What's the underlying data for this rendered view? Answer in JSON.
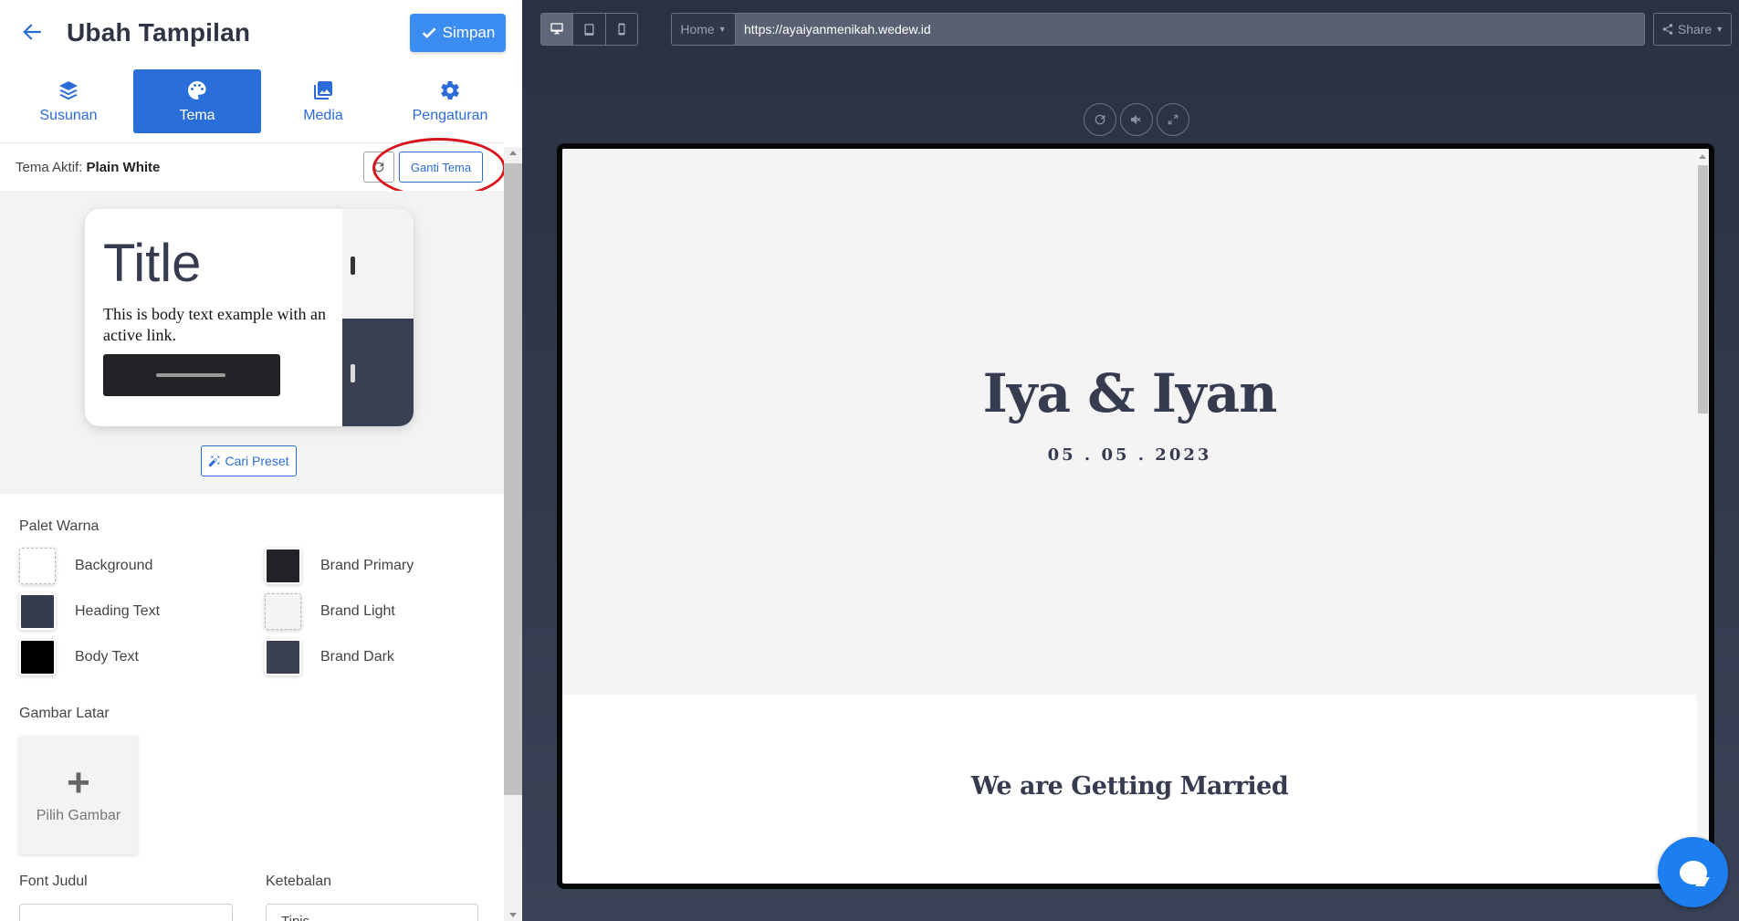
{
  "header": {
    "title": "Ubah Tampilan",
    "save_label": "Simpan"
  },
  "tabs": [
    {
      "label": "Susunan",
      "icon": "layers-icon"
    },
    {
      "label": "Tema",
      "icon": "palette-icon",
      "active": true
    },
    {
      "label": "Media",
      "icon": "images-icon"
    },
    {
      "label": "Pengaturan",
      "icon": "gear-icon"
    }
  ],
  "theme": {
    "active_prefix": "Tema Aktif:",
    "active_name": "Plain White",
    "change_label": "Ganti Tema",
    "preview": {
      "title": "Title",
      "body": "This is body text example with an active link."
    },
    "preset_label": "Cari Preset"
  },
  "palette": {
    "heading": "Palet Warna",
    "colors": [
      {
        "label": "Background",
        "color": "#ffffff"
      },
      {
        "label": "Brand Primary",
        "color": "#222326"
      },
      {
        "label": "Heading Text",
        "color": "#363b4f"
      },
      {
        "label": "Brand Light",
        "color": "#f4f4f5"
      },
      {
        "label": "Body Text",
        "color": "#000000"
      },
      {
        "label": "Brand Dark",
        "color": "#3b3f54"
      }
    ]
  },
  "background_image": {
    "heading": "Gambar Latar",
    "button_label": "Pilih Gambar"
  },
  "fonts": {
    "title_label": "Font Judul",
    "weight_label": "Ketebalan",
    "weight_value": "Tipis"
  },
  "preview_toolbar": {
    "page_select": "Home",
    "url": "https://ayaiyanmenikah.wedew.id",
    "share_label": "Share"
  },
  "site": {
    "couple": "Iya & Iyan",
    "date": "05 . 05 . 2023",
    "section_title": "We are Getting Married"
  }
}
